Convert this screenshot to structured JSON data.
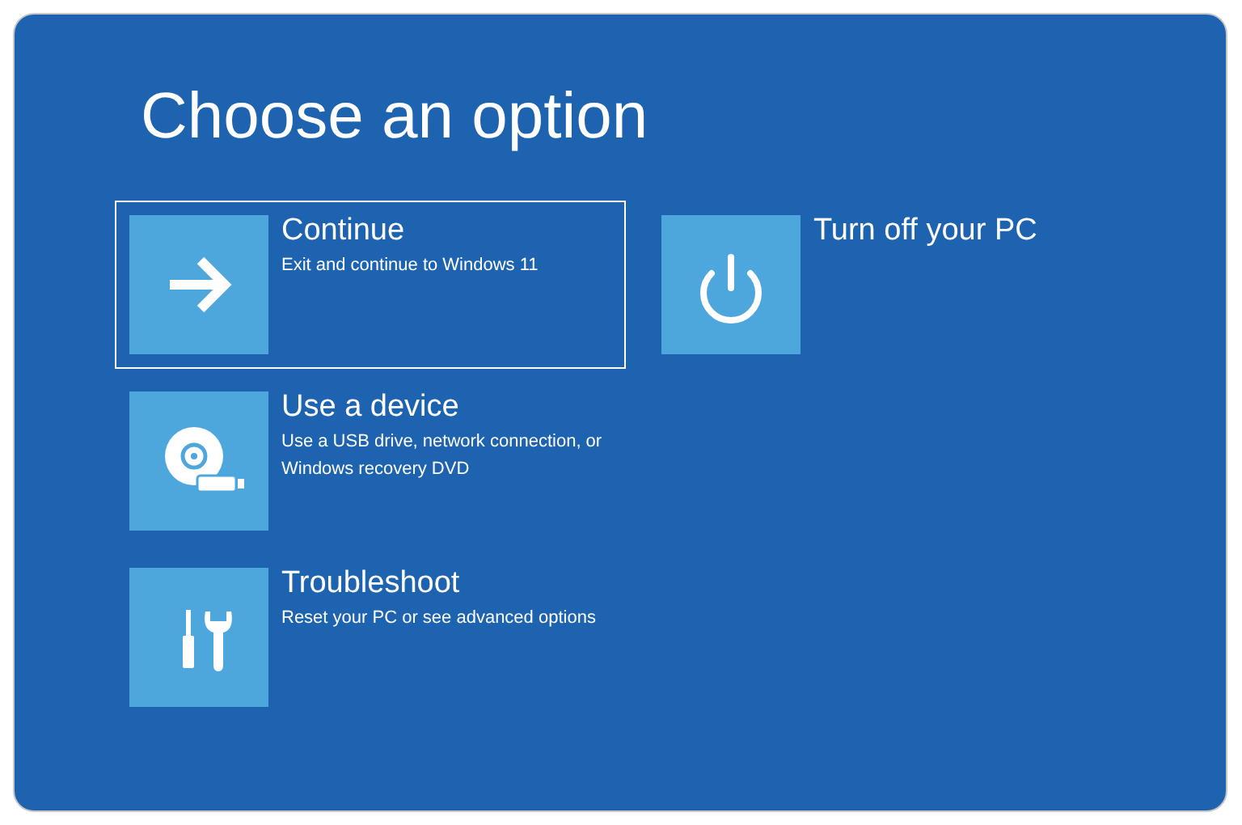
{
  "title": "Choose an option",
  "options": [
    {
      "kind": "arrow",
      "label": "Continue",
      "description": "Exit and continue to Windows 11",
      "selected": true
    },
    {
      "kind": "device",
      "label": "Use a device",
      "description": "Use a USB drive, network connection, or Windows recovery DVD",
      "selected": false
    },
    {
      "kind": "tools",
      "label": "Troubleshoot",
      "description": "Reset your PC or see advanced options",
      "selected": false
    },
    {
      "kind": "power",
      "label": "Turn off your PC",
      "selected": false
    }
  ]
}
